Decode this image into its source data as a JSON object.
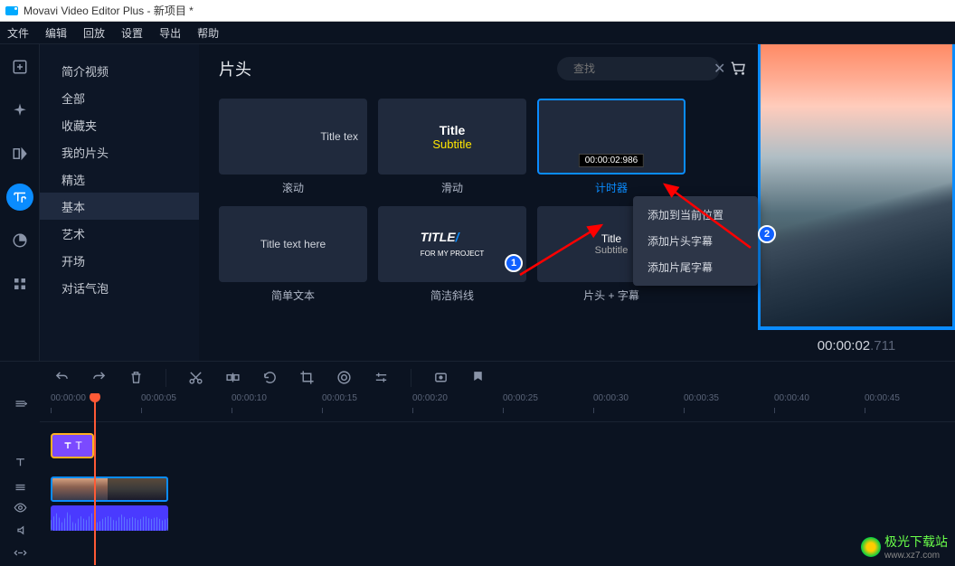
{
  "window": {
    "title": "Movavi Video Editor Plus - 新项目 *"
  },
  "menu": [
    "文件",
    "编辑",
    "回放",
    "设置",
    "导出",
    "帮助"
  ],
  "sidebar": {
    "items": [
      "简介视频",
      "全部",
      "收藏夹",
      "我的片头",
      "精选",
      "基本",
      "艺术",
      "开场",
      "对话气泡"
    ],
    "active_index": 5
  },
  "browser": {
    "title": "片头",
    "search_placeholder": "查找",
    "tiles": [
      {
        "label": "滚动",
        "preview": "Title tex"
      },
      {
        "label": "滑动",
        "title": "Title",
        "subtitle": "Subtitle"
      },
      {
        "label": "计时器",
        "timer": "00:00:02:986",
        "selected": true
      },
      {
        "label": "简单文本",
        "preview": "Title text here"
      },
      {
        "label": "简洁斜线",
        "title": "TITLE",
        "subtitle": "FOR MY PROJECT"
      },
      {
        "label": "片头 + 字幕",
        "title": "Title",
        "subtitle": "Subtitle"
      }
    ]
  },
  "context_menu": [
    "添加到当前位置",
    "添加片头字幕",
    "添加片尾字幕"
  ],
  "preview": {
    "time_main": "00:00:02",
    "time_ms": ".711"
  },
  "ruler": [
    "00:00:00",
    "00:00:05",
    "00:00:10",
    "00:00:15",
    "00:00:20",
    "00:00:25",
    "00:00:30",
    "00:00:35",
    "00:00:40",
    "00:00:45"
  ],
  "annotations": {
    "badge1": "1",
    "badge2": "2"
  },
  "watermark": {
    "text": "极光下载站",
    "url": "www.xz7.com"
  }
}
